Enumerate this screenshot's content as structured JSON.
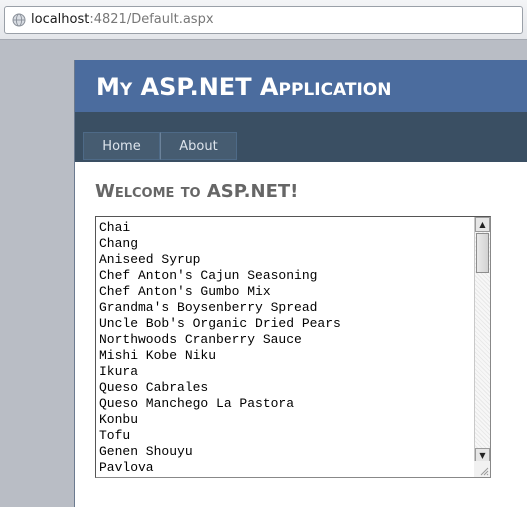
{
  "browser": {
    "url_host": "localhost",
    "url_rest": ":4821/Default.aspx"
  },
  "header": {
    "title": "My ASP.NET Application"
  },
  "menu": {
    "items": [
      {
        "label": "Home"
      },
      {
        "label": "About"
      }
    ]
  },
  "main": {
    "heading": "Welcome to ASP.NET!",
    "products": [
      "Chai",
      "Chang",
      "Aniseed Syrup",
      "Chef Anton's Cajun Seasoning",
      "Chef Anton's Gumbo Mix",
      "Grandma's Boysenberry Spread",
      "Uncle Bob's Organic Dried Pears",
      "Northwoods Cranberry Sauce",
      "Mishi Kobe Niku",
      "Ikura",
      "Queso Cabrales",
      "Queso Manchego La Pastora",
      "Konbu",
      "Tofu",
      "Genen Shouyu",
      "Pavlova"
    ]
  },
  "icons": {
    "address": "globe-icon",
    "scroll_up": "arrow-up-icon",
    "scroll_down": "arrow-down-icon",
    "resize": "resize-grip-icon"
  },
  "colors": {
    "header_bg": "#4b6c9e",
    "nav_bg": "#3a4f63",
    "menu_item_bg": "#465c71",
    "heading_text": "#666666"
  }
}
